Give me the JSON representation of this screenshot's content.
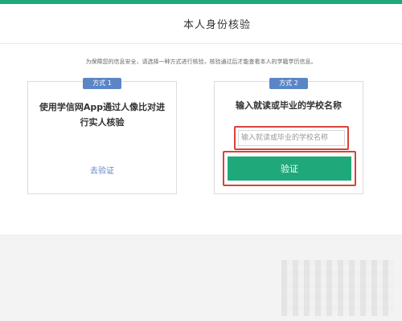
{
  "header": {
    "title": "本人身份核验"
  },
  "notice": {
    "text": "为保障您的信息安全，请选择一种方式进行核验，核验通过后才能查看本人的学籍学历信息。"
  },
  "methods": [
    {
      "badge": "方式 1",
      "title": "使用学信网App通过人像比对进行实人核验",
      "link_label": "去验证"
    },
    {
      "badge": "方式 2",
      "title": "输入就读或毕业的学校名称",
      "input_placeholder": "输入就读或毕业的学校名称",
      "button_label": "验证"
    }
  ],
  "colors": {
    "brand": "#1fa97a",
    "badge": "#5b86c6",
    "highlight": "#d8433a"
  }
}
